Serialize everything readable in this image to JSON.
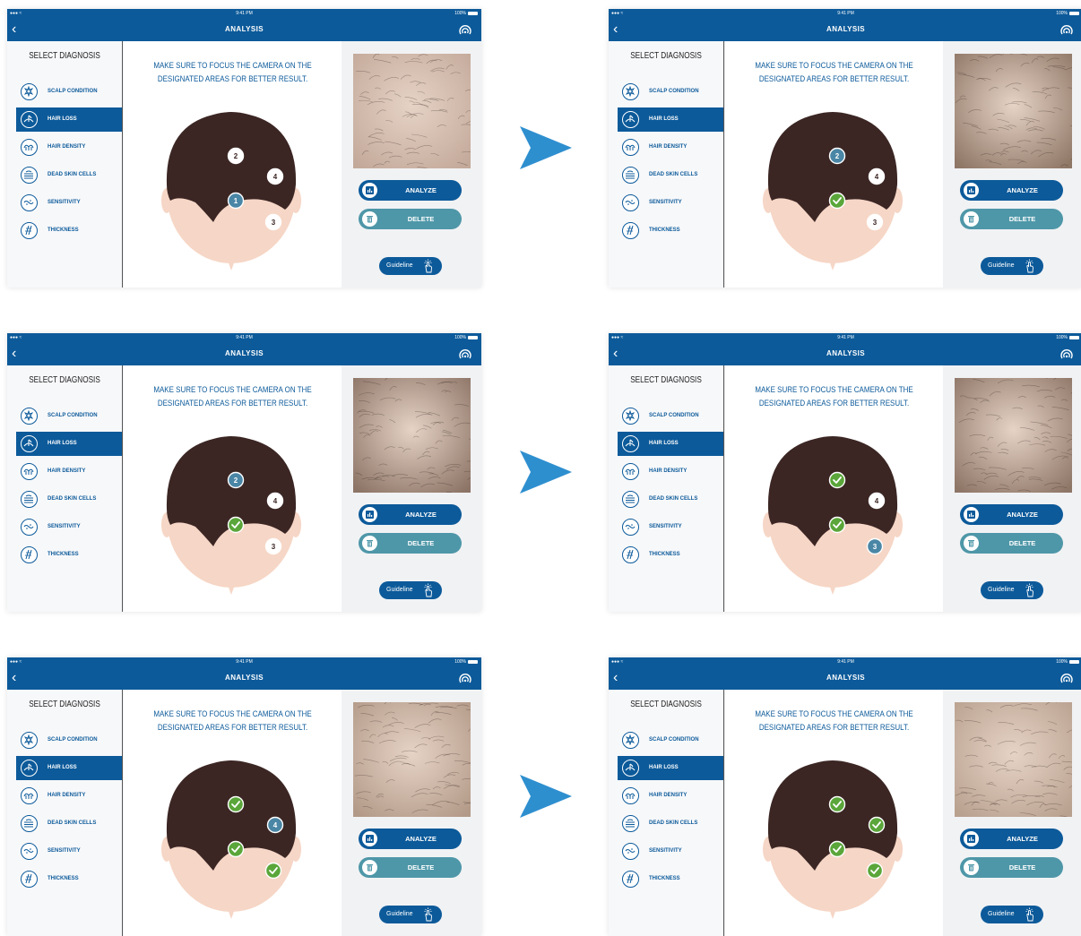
{
  "screens": [
    {
      "status": {
        "time": "9:41 PM",
        "battery": "100%"
      },
      "nav": {
        "title": "ANALYSIS"
      },
      "sidebar": {
        "heading": "SELECT DIAGNOSIS",
        "items": [
          "SCALP CONDITION",
          "HAIR LOSS",
          "HAIR DENSITY",
          "DEAD SKIN CELLS",
          "SENSITIVITY",
          "THICKNESS"
        ],
        "active_index": 1
      },
      "instruction": [
        "MAKE SURE TO FOCUS THE CAMERA ON THE",
        "DESIGNATED AREAS FOR BETTER RESULT."
      ],
      "buttons": {
        "analyze": "ANALYZE",
        "delete": "DELETE",
        "guideline": "Guideline"
      },
      "markers": [
        {
          "label": "1",
          "state": "active"
        },
        {
          "label": "2",
          "state": "pending"
        },
        {
          "label": "3",
          "state": "pending"
        },
        {
          "label": "4",
          "state": "pending"
        }
      ],
      "photo_tone": "#c3a99a"
    },
    {
      "status": {
        "time": "9:41 PM",
        "battery": "100%"
      },
      "nav": {
        "title": "ANALYSIS"
      },
      "sidebar": {
        "heading": "SELECT DIAGNOSIS",
        "items": [
          "SCALP CONDITION",
          "HAIR LOSS",
          "HAIR DENSITY",
          "DEAD SKIN CELLS",
          "SENSITIVITY",
          "THICKNESS"
        ],
        "active_index": 1
      },
      "instruction": [
        "MAKE SURE TO FOCUS THE CAMERA ON THE",
        "DESIGNATED AREAS FOR BETTER RESULT."
      ],
      "buttons": {
        "analyze": "ANALYZE",
        "delete": "DELETE",
        "guideline": "Guideline"
      },
      "markers": [
        {
          "label": "1",
          "state": "done"
        },
        {
          "label": "2",
          "state": "active"
        },
        {
          "label": "3",
          "state": "pending"
        },
        {
          "label": "4",
          "state": "pending"
        }
      ],
      "photo_tone": "#8f7766"
    },
    {
      "status": {
        "time": "9:41 PM",
        "battery": "100%"
      },
      "nav": {
        "title": "ANALYSIS"
      },
      "sidebar": {
        "heading": "SELECT DIAGNOSIS",
        "items": [
          "SCALP CONDITION",
          "HAIR LOSS",
          "HAIR DENSITY",
          "DEAD SKIN CELLS",
          "SENSITIVITY",
          "THICKNESS"
        ],
        "active_index": 1
      },
      "instruction": [
        "MAKE SURE TO FOCUS THE CAMERA ON THE",
        "DESIGNATED AREAS FOR BETTER RESULT."
      ],
      "buttons": {
        "analyze": "ANALYZE",
        "delete": "DELETE",
        "guideline": "Guideline"
      },
      "markers": [
        {
          "label": "1",
          "state": "done"
        },
        {
          "label": "2",
          "state": "active"
        },
        {
          "label": "3",
          "state": "pending"
        },
        {
          "label": "4",
          "state": "pending"
        }
      ],
      "photo_tone": "#8c7466"
    },
    {
      "status": {
        "time": "9:41 PM",
        "battery": "100%"
      },
      "nav": {
        "title": "ANALYSIS"
      },
      "sidebar": {
        "heading": "SELECT DIAGNOSIS",
        "items": [
          "SCALP CONDITION",
          "HAIR LOSS",
          "HAIR DENSITY",
          "DEAD SKIN CELLS",
          "SENSITIVITY",
          "THICKNESS"
        ],
        "active_index": 1
      },
      "instruction": [
        "MAKE SURE TO FOCUS THE CAMERA ON THE",
        "DESIGNATED AREAS FOR BETTER RESULT."
      ],
      "buttons": {
        "analyze": "ANALYZE",
        "delete": "DELETE",
        "guideline": "Guideline"
      },
      "markers": [
        {
          "label": "1",
          "state": "done"
        },
        {
          "label": "2",
          "state": "done"
        },
        {
          "label": "3",
          "state": "active"
        },
        {
          "label": "4",
          "state": "pending"
        }
      ],
      "photo_tone": "#8e7667"
    },
    {
      "status": {
        "time": "9:41 PM",
        "battery": "100%"
      },
      "nav": {
        "title": "ANALYSIS"
      },
      "sidebar": {
        "heading": "SELECT DIAGNOSIS",
        "items": [
          "SCALP CONDITION",
          "HAIR LOSS",
          "HAIR DENSITY",
          "DEAD SKIN CELLS",
          "SENSITIVITY",
          "THICKNESS"
        ],
        "active_index": 1
      },
      "instruction": [
        "MAKE SURE TO FOCUS THE CAMERA ON THE",
        "DESIGNATED AREAS FOR BETTER RESULT."
      ],
      "buttons": {
        "analyze": "ANALYZE",
        "delete": "DELETE",
        "guideline": "Guideline"
      },
      "markers": [
        {
          "label": "1",
          "state": "done"
        },
        {
          "label": "2",
          "state": "done"
        },
        {
          "label": "3",
          "state": "done"
        },
        {
          "label": "4",
          "state": "active"
        }
      ],
      "photo_tone": "#b39a88"
    },
    {
      "status": {
        "time": "9:41 PM",
        "battery": "100%"
      },
      "nav": {
        "title": "ANALYSIS"
      },
      "sidebar": {
        "heading": "SELECT DIAGNOSIS",
        "items": [
          "SCALP CONDITION",
          "HAIR LOSS",
          "HAIR DENSITY",
          "DEAD SKIN CELLS",
          "SENSITIVITY",
          "THICKNESS"
        ],
        "active_index": 1
      },
      "instruction": [
        "MAKE SURE TO FOCUS THE CAMERA ON THE",
        "DESIGNATED AREAS FOR BETTER RESULT."
      ],
      "buttons": {
        "analyze": "ANALYZE",
        "delete": "DELETE",
        "guideline": "Guideline"
      },
      "markers": [
        {
          "label": "1",
          "state": "done"
        },
        {
          "label": "2",
          "state": "done"
        },
        {
          "label": "3",
          "state": "done"
        },
        {
          "label": "4",
          "state": "done"
        }
      ],
      "photo_tone": "#b9a18f"
    }
  ],
  "colors": {
    "brand": "#0c5a9a",
    "delete": "#4e97a8",
    "hair": "#3b2624",
    "skin": "#f6d6c6",
    "done": "#5aa63a",
    "arrow": "#2e8fcf"
  },
  "icons": {
    "sidebar": [
      "scalp-condition-icon",
      "hair-loss-icon",
      "hair-density-icon",
      "dead-skin-cells-icon",
      "sensitivity-icon",
      "thickness-icon"
    ],
    "flow": "arrow-right-icon"
  }
}
